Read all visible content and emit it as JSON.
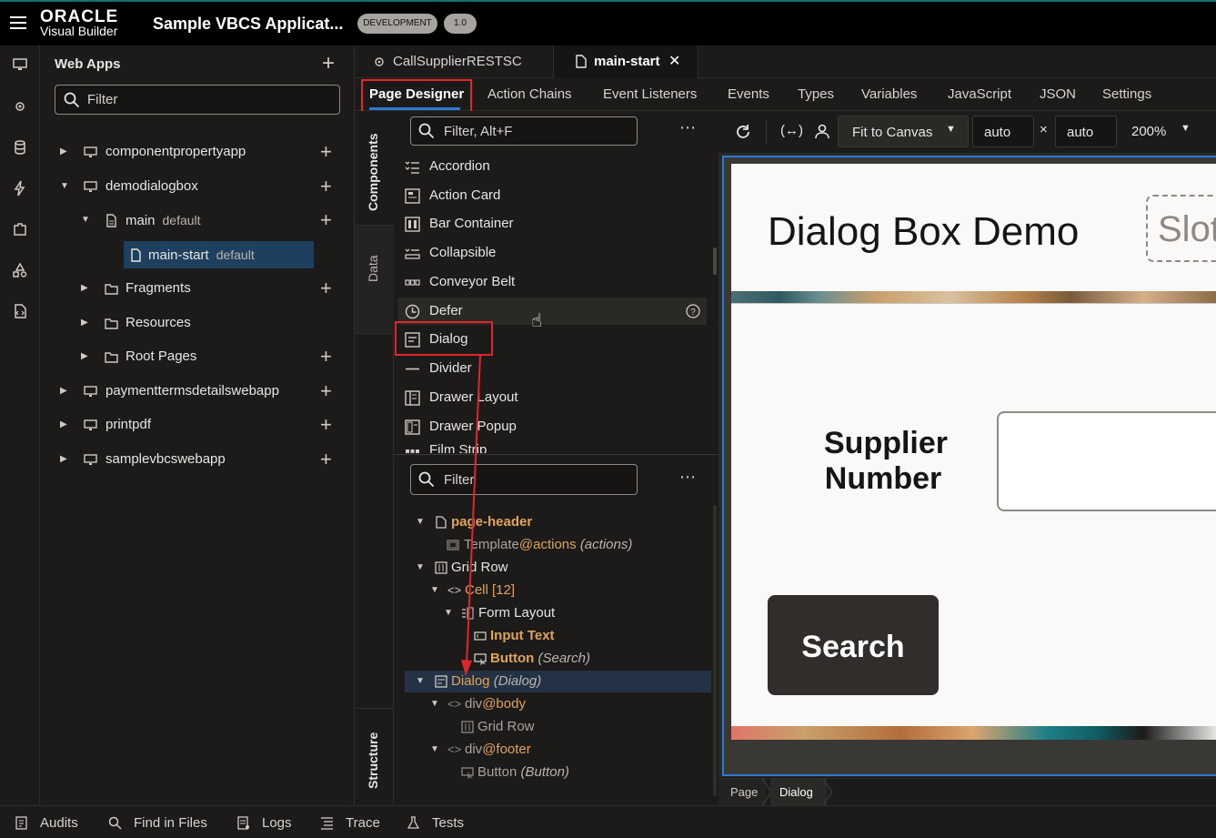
{
  "brand": {
    "line1": "ORACLE",
    "line2": "Visual Builder"
  },
  "app_title": "Sample VBCS Applicat...",
  "badges": {
    "env": "DEVELOPMENT",
    "version": "1.0"
  },
  "webapps": {
    "title": "Web Apps",
    "filter_placeholder": "Filter",
    "items": [
      {
        "label": "componentpropertyapp"
      },
      {
        "label": "demodialogbox"
      },
      {
        "label": "main",
        "sub": "default"
      },
      {
        "label": "main-start",
        "sub": "default"
      },
      {
        "label": "Fragments"
      },
      {
        "label": "Resources"
      },
      {
        "label": "Root Pages"
      },
      {
        "label": "paymenttermsdetailswebapp"
      },
      {
        "label": "printpdf"
      },
      {
        "label": "samplevbcswebapp"
      }
    ]
  },
  "editor_tabs": [
    {
      "label": "CallSupplierRESTSC"
    },
    {
      "label": "main-start"
    }
  ],
  "designer_tabs": [
    "Page Designer",
    "Action Chains",
    "Event Listeners",
    "Events",
    "Types",
    "Variables",
    "JavaScript",
    "JSON",
    "Settings"
  ],
  "side_tabs": {
    "components": "Components",
    "data": "Data",
    "structure": "Structure"
  },
  "components": {
    "filter_placeholder": "Filter, Alt+F",
    "items": [
      "Accordion",
      "Action Card",
      "Bar Container",
      "Collapsible",
      "Conveyor Belt",
      "Defer",
      "Dialog",
      "Divider",
      "Drawer Layout",
      "Drawer Popup",
      "Film Strip"
    ]
  },
  "structure": {
    "filter_placeholder": "Filter",
    "rows": {
      "page_header": "page-header",
      "template": "Template",
      "template_slot": "@actions",
      "template_note": "(actions)",
      "grid_row": "Grid Row",
      "cell": "Cell [12]",
      "form_layout": "Form Layout",
      "input_text": "Input Text",
      "button": "Button",
      "button_note": "(Search)",
      "dialog": "Dialog",
      "dialog_note": "(Dialog)",
      "div_body": "div",
      "div_body_slot": "@body",
      "grid_row2": "Grid Row",
      "div_footer": "div",
      "div_footer_slot": "@footer",
      "button2": "Button",
      "button2_note": "(Button)"
    }
  },
  "toolbar": {
    "fit": "Fit to Canvas",
    "width": "auto",
    "times": "×",
    "height": "auto",
    "zoom": "200%"
  },
  "canvas": {
    "heading": "Dialog Box Demo",
    "slot": "Slot",
    "field_label_1": "Supplier",
    "field_label_2": "Number",
    "search_button": "Search"
  },
  "breadcrumb": [
    "Page",
    "Dialog"
  ],
  "bottom": [
    "Audits",
    "Find in Files",
    "Logs",
    "Trace",
    "Tests"
  ],
  "colors": {
    "accent": "#2b7bd6",
    "highlight_box": "#e0262d",
    "slot_orange": "#e0a35b"
  }
}
